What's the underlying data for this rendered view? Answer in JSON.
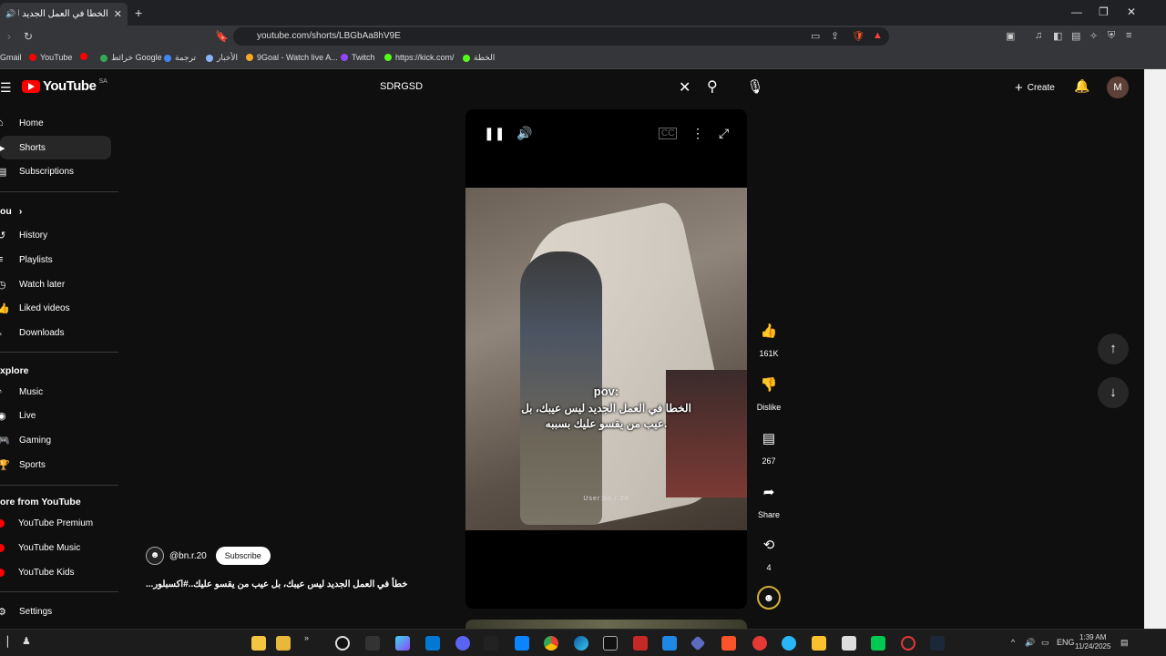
{
  "browser": {
    "tab_title": "الخطا في العمل الجديد ليس عيب",
    "url": "youtube.com/shorts/LBGbAa8hV9E",
    "bookmarks": [
      "Gmail",
      "YouTube",
      "خرائط Google",
      "ترجمة",
      "الأخبار",
      "9Goal - Watch live A...",
      "Twitch",
      "https://kick.com/",
      "الخطة"
    ]
  },
  "youtube": {
    "search_value": "SDRGSD",
    "create_label": "Create",
    "avatar_letter": "M",
    "logo_text": "YouTube",
    "logo_sup": "SA"
  },
  "sidebar": {
    "main": [
      {
        "label": "Home",
        "icon": "home-icon"
      },
      {
        "label": "Shorts",
        "icon": "shorts-icon"
      },
      {
        "label": "Subscriptions",
        "icon": "subscriptions-icon"
      }
    ],
    "you_head": "ou",
    "you": [
      {
        "label": "History",
        "icon": "history-icon"
      },
      {
        "label": "Playlists",
        "icon": "playlists-icon"
      },
      {
        "label": "Watch later",
        "icon": "clock-icon"
      },
      {
        "label": "Liked videos",
        "icon": "thumbs-up-icon"
      },
      {
        "label": "Downloads",
        "icon": "download-icon"
      }
    ],
    "explore_head": "xplore",
    "explore": [
      {
        "label": "Music",
        "icon": "music-icon"
      },
      {
        "label": "Live",
        "icon": "live-icon"
      },
      {
        "label": "Gaming",
        "icon": "gaming-icon"
      },
      {
        "label": "Sports",
        "icon": "trophy-icon"
      }
    ],
    "more_head": "ore from YouTube",
    "more": [
      {
        "label": "YouTube Premium"
      },
      {
        "label": "YouTube Music"
      },
      {
        "label": "YouTube Kids"
      }
    ],
    "settings": "Settings"
  },
  "short": {
    "overlay_pov": "pov:",
    "overlay_line1": "الخطا في العمل الجديد ليس عيبك، بل",
    "overlay_line2": "عيب من يقسو عليك بسببه.",
    "watermark": "User:bn.r.20",
    "likes": "161K",
    "dislike": "Dislike",
    "comments": "267",
    "share": "Share",
    "remix": "4",
    "channel": "@bn.r.20",
    "subscribe": "Subscribe",
    "caption": "خطأ في العمل الجديد ليس عيبك، بل عيب من يقسو عليك..#اكسبلور..."
  },
  "system": {
    "lang": "ENG",
    "time": "1:39 AM",
    "date": "11/24/2025"
  }
}
